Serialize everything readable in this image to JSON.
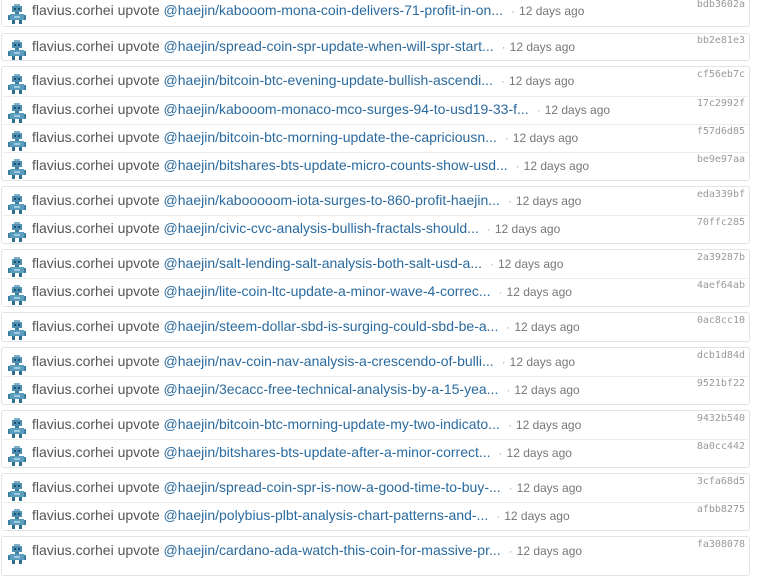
{
  "ops": [
    {
      "actor": "flavius.corhei",
      "verb": "upvote",
      "link": "@haejin/kabooom-mona-coin-delivers-71-profit-in-on...",
      "age": "12 days ago",
      "hash": "bdb3602a"
    },
    {
      "actor": "flavius.corhei",
      "verb": "upvote",
      "link": "@haejin/spread-coin-spr-update-when-will-spr-start...",
      "age": "12 days ago",
      "hash": "bb2e81e3"
    },
    {
      "actor": "flavius.corhei",
      "verb": "upvote",
      "link": "@haejin/bitcoin-btc-evening-update-bullish-ascendi...",
      "age": "12 days ago",
      "hash": "cf56eb7c"
    },
    {
      "actor": "flavius.corhei",
      "verb": "upvote",
      "link": "@haejin/kabooom-monaco-mco-surges-94-to-usd19-33-f...",
      "age": "12 days ago",
      "hash": "17c2992f"
    },
    {
      "actor": "flavius.corhei",
      "verb": "upvote",
      "link": "@haejin/bitcoin-btc-morning-update-the-capriciousn...",
      "age": "12 days ago",
      "hash": "f57d6d85"
    },
    {
      "actor": "flavius.corhei",
      "verb": "upvote",
      "link": "@haejin/bitshares-bts-update-micro-counts-show-usd...",
      "age": "12 days ago",
      "hash": "be9e97aa"
    },
    {
      "actor": "flavius.corhei",
      "verb": "upvote",
      "link": "@haejin/kabooooom-iota-surges-to-860-profit-haejin...",
      "age": "12 days ago",
      "hash": "eda339bf"
    },
    {
      "actor": "flavius.corhei",
      "verb": "upvote",
      "link": "@haejin/civic-cvc-analysis-bullish-fractals-should...",
      "age": "12 days ago",
      "hash": "70ffc285"
    },
    {
      "actor": "flavius.corhei",
      "verb": "upvote",
      "link": "@haejin/salt-lending-salt-analysis-both-salt-usd-a...",
      "age": "12 days ago",
      "hash": "2a39287b"
    },
    {
      "actor": "flavius.corhei",
      "verb": "upvote",
      "link": "@haejin/lite-coin-ltc-update-a-minor-wave-4-correc...",
      "age": "12 days ago",
      "hash": "4aef64ab"
    },
    {
      "actor": "flavius.corhei",
      "verb": "upvote",
      "link": "@haejin/steem-dollar-sbd-is-surging-could-sbd-be-a...",
      "age": "12 days ago",
      "hash": "0ac8cc10"
    },
    {
      "actor": "flavius.corhei",
      "verb": "upvote",
      "link": "@haejin/nav-coin-nav-analysis-a-crescendo-of-bulli...",
      "age": "12 days ago",
      "hash": "dcb1d84d"
    },
    {
      "actor": "flavius.corhei",
      "verb": "upvote",
      "link": "@haejin/3ecacc-free-technical-analysis-by-a-15-yea...",
      "age": "12 days ago",
      "hash": "9521bf22"
    },
    {
      "actor": "flavius.corhei",
      "verb": "upvote",
      "link": "@haejin/bitcoin-btc-morning-update-my-two-indicato...",
      "age": "12 days ago",
      "hash": "9432b540"
    },
    {
      "actor": "flavius.corhei",
      "verb": "upvote",
      "link": "@haejin/bitshares-bts-update-after-a-minor-correct...",
      "age": "12 days ago",
      "hash": "8a0cc442"
    },
    {
      "actor": "flavius.corhei",
      "verb": "upvote",
      "link": "@haejin/spread-coin-spr-is-now-a-good-time-to-buy-...",
      "age": "12 days ago",
      "hash": "3cfa68d5"
    },
    {
      "actor": "flavius.corhei",
      "verb": "upvote",
      "link": "@haejin/polybius-plbt-analysis-chart-patterns-and-...",
      "age": "12 days ago",
      "hash": "afbb8275"
    },
    {
      "actor": "flavius.corhei",
      "verb": "upvote",
      "link": "@haejin/cardano-ada-watch-this-coin-for-massive-pr...",
      "age": "12 days ago",
      "hash": "fa308078"
    }
  ],
  "icons": {
    "avatar": "avatar-icon"
  },
  "colors": {
    "link": "#2a6a9e",
    "text": "#555555",
    "muted": "#777777",
    "hash": "#999999",
    "border": "#e3e3e3"
  }
}
